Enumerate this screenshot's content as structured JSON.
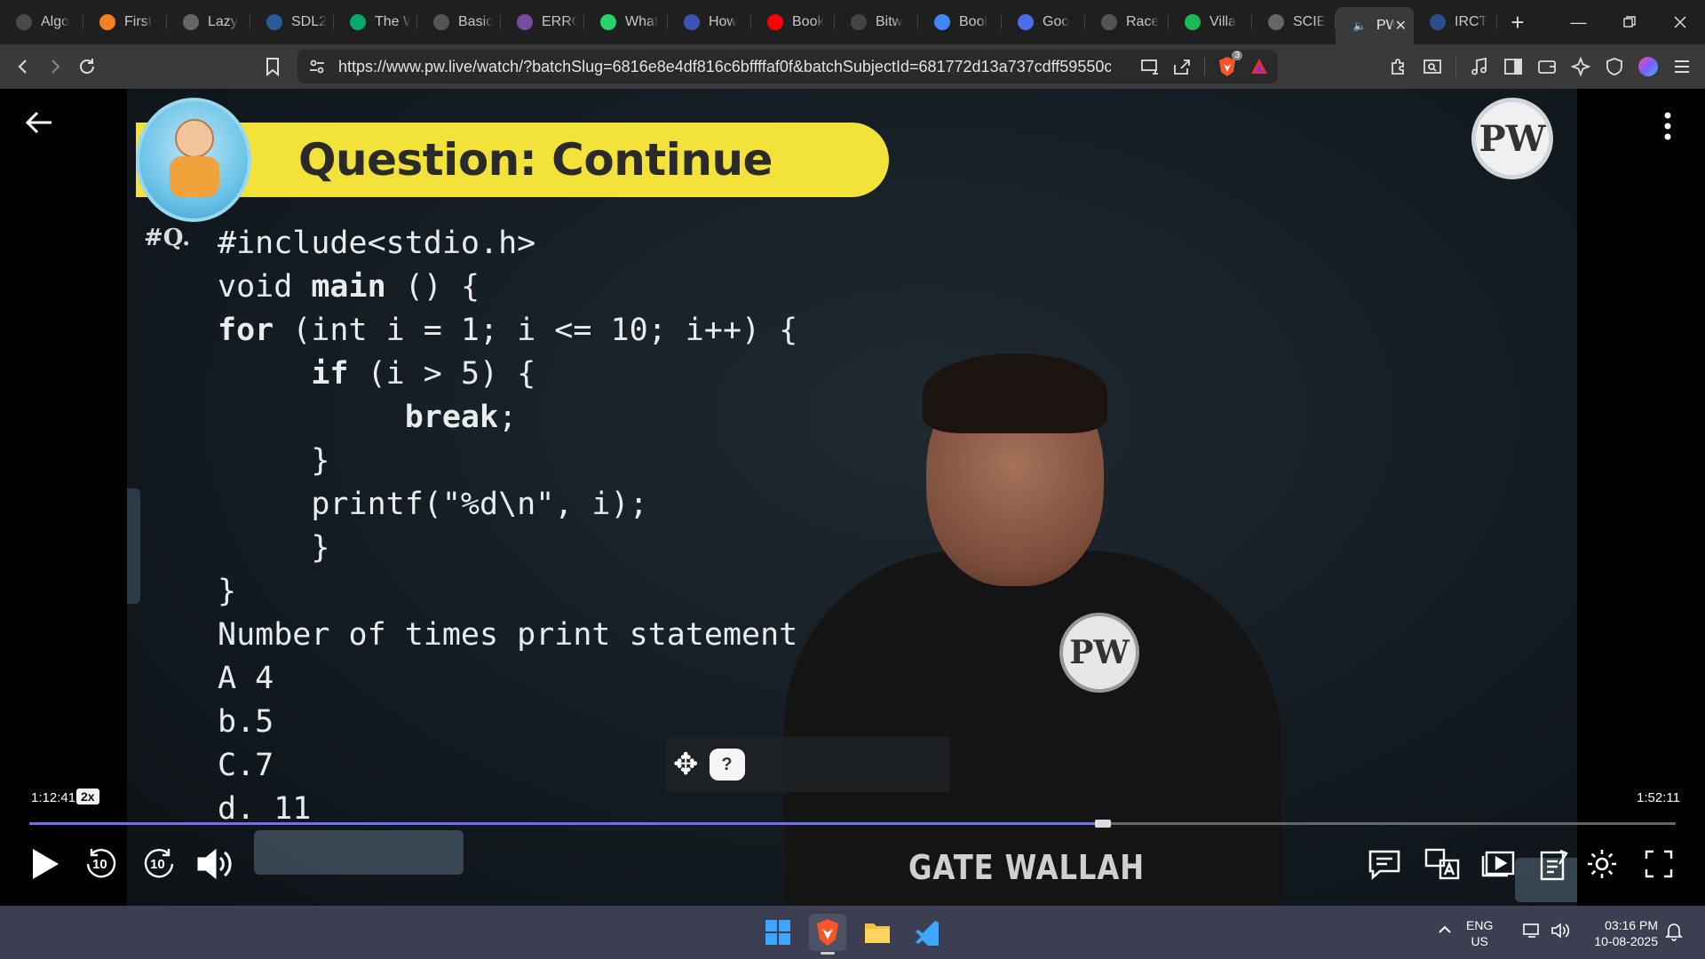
{
  "tabs": [
    {
      "title": "Algo",
      "icon": "robot-icon",
      "color": "#4a4a4a"
    },
    {
      "title": "First",
      "icon": "stack-icon",
      "color": "#f48024"
    },
    {
      "title": "Lazy",
      "icon": "globe-icon",
      "color": "#666"
    },
    {
      "title": "SDL2",
      "icon": "sdl-icon",
      "color": "#2a5a9a"
    },
    {
      "title": "The W",
      "icon": "w3-icon",
      "color": "#04aa6d"
    },
    {
      "title": "Basic",
      "icon": "code-icon",
      "color": "#555"
    },
    {
      "title": "ERRO",
      "icon": "error-icon",
      "color": "#7a4aa0"
    },
    {
      "title": "What",
      "icon": "whatsapp-icon",
      "color": "#25d366"
    },
    {
      "title": "How",
      "icon": "bookmark-icon",
      "color": "#3f51b5"
    },
    {
      "title": "Book",
      "icon": "youtube-icon",
      "color": "#ff0000"
    },
    {
      "title": "Bitw",
      "icon": "bitwise-icon",
      "color": "#444"
    },
    {
      "title": "Bool",
      "icon": "google-icon",
      "color": "#4285f4"
    },
    {
      "title": "Goo",
      "icon": "gemini-icon",
      "color": "#4b6ce6"
    },
    {
      "title": "Race",
      "icon": "openai-icon",
      "color": "#555"
    },
    {
      "title": "Villa",
      "icon": "spotify-icon",
      "color": "#1db954"
    },
    {
      "title": "SCIE",
      "icon": "globe-icon",
      "color": "#666"
    }
  ],
  "active_tab": {
    "title": "PW",
    "icon": "speaker-icon",
    "close": "✕"
  },
  "last_tab": {
    "title": "IRCT",
    "icon": "irctc-icon",
    "color": "#2b4d8c"
  },
  "browser": {
    "url": "https://www.pw.live/watch/?batchSlug=6816e8e4df816c6bffffaf0f&batchSubjectId=681772d13a737cdff59550c...",
    "brave_badge": "3"
  },
  "video": {
    "banner_title": "Question: Continue",
    "question_label": "#Q.",
    "code_lines": [
      "#include<stdio.h>",
      "void main () {",
      "for (int i = 1; i <= 10; i++) {",
      "     if (i > 5) {",
      "          break;",
      "     }",
      "     printf(\"%d\\n\", i);",
      "     }",
      "}",
      "Number of times print statement e",
      "A 4",
      "b.5",
      "C.7",
      "d. 11"
    ],
    "logo_text": "PW",
    "badge_text": "PW",
    "watermark": "GATE WALLAH",
    "help_glyph": "?"
  },
  "player": {
    "current_time": "1:12:41",
    "speed": "2x",
    "total_time": "1:52:11",
    "progress": 0.652,
    "skip_back": "10",
    "skip_forward": "10"
  },
  "taskbar": {
    "lang_line1": "ENG",
    "lang_line2": "US",
    "time": "03:16 PM",
    "date": "10-08-2025"
  }
}
